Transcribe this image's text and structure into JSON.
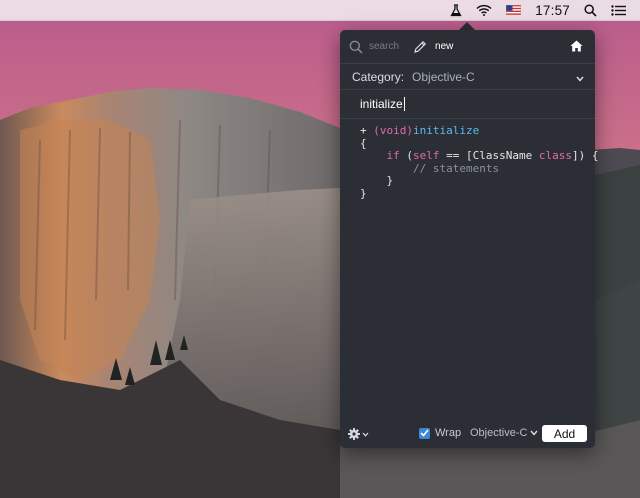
{
  "menubar": {
    "clock": "17:57",
    "icons": [
      "flask-icon",
      "wifi-icon",
      "flag-icon",
      "spotlight-search-icon",
      "notification-center-icon"
    ]
  },
  "popover": {
    "toolbar": {
      "search_label": "search",
      "new_label": "new",
      "home_icon": "home-icon"
    },
    "category": {
      "label": "Category:",
      "value": "Objective-C"
    },
    "snippet_title": "initialize",
    "code_lines": [
      "+ (void)initialize",
      "{",
      "    if (self == [ClassName class]) {",
      "        // statements",
      "    }",
      "}"
    ],
    "bottom": {
      "wrap_label": "Wrap",
      "wrap_checked": true,
      "language": "Objective-C",
      "add_label": "Add"
    }
  },
  "colors": {
    "popover_bg": "#2b2e35",
    "keyword": "#e06ca8",
    "function": "#5fb7ee",
    "comment": "#8a8f99",
    "checkbox": "#3d86d6"
  }
}
